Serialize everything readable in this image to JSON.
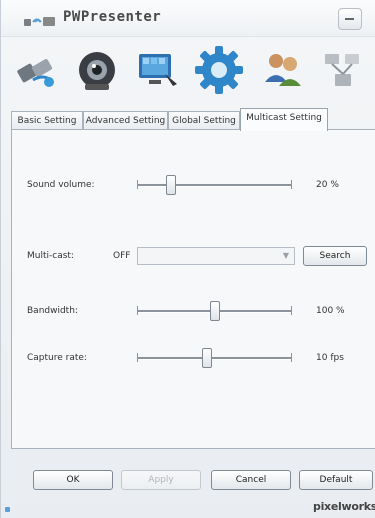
{
  "window": {
    "title": "PWPresenter",
    "minimize_icon": "minimize-icon"
  },
  "toolbar": {
    "items": [
      {
        "icon": "connection-icon"
      },
      {
        "icon": "webcam-icon"
      },
      {
        "icon": "display-icon"
      },
      {
        "icon": "settings-gear-icon"
      },
      {
        "icon": "users-icon"
      },
      {
        "icon": "network-icon"
      }
    ]
  },
  "tabs": [
    {
      "label": "Basic Setting",
      "active": false
    },
    {
      "label": "Advanced Setting",
      "active": false
    },
    {
      "label": "Global Setting",
      "active": false
    },
    {
      "label": "Multicast Setting",
      "active": true
    }
  ],
  "settings": {
    "sound_volume": {
      "label": "Sound volume:",
      "value_text": "20 %",
      "level": 0.2
    },
    "multicast": {
      "label": "Multi-cast:",
      "state": "OFF",
      "search_label": "Search"
    },
    "bandwidth": {
      "label": "Bandwidth:",
      "value_text": "100 %",
      "level": 0.5
    },
    "capture_rate": {
      "label": "Capture rate:",
      "value_text": "10 fps",
      "level": 0.45
    }
  },
  "buttons": {
    "ok": "OK",
    "apply": "Apply",
    "cancel": "Cancel",
    "default": "Default"
  },
  "footer": {
    "brand": "pixelworks"
  },
  "colors": {
    "gear_blue": "#2f86c8",
    "accent_blue": "#5aa0d8"
  }
}
